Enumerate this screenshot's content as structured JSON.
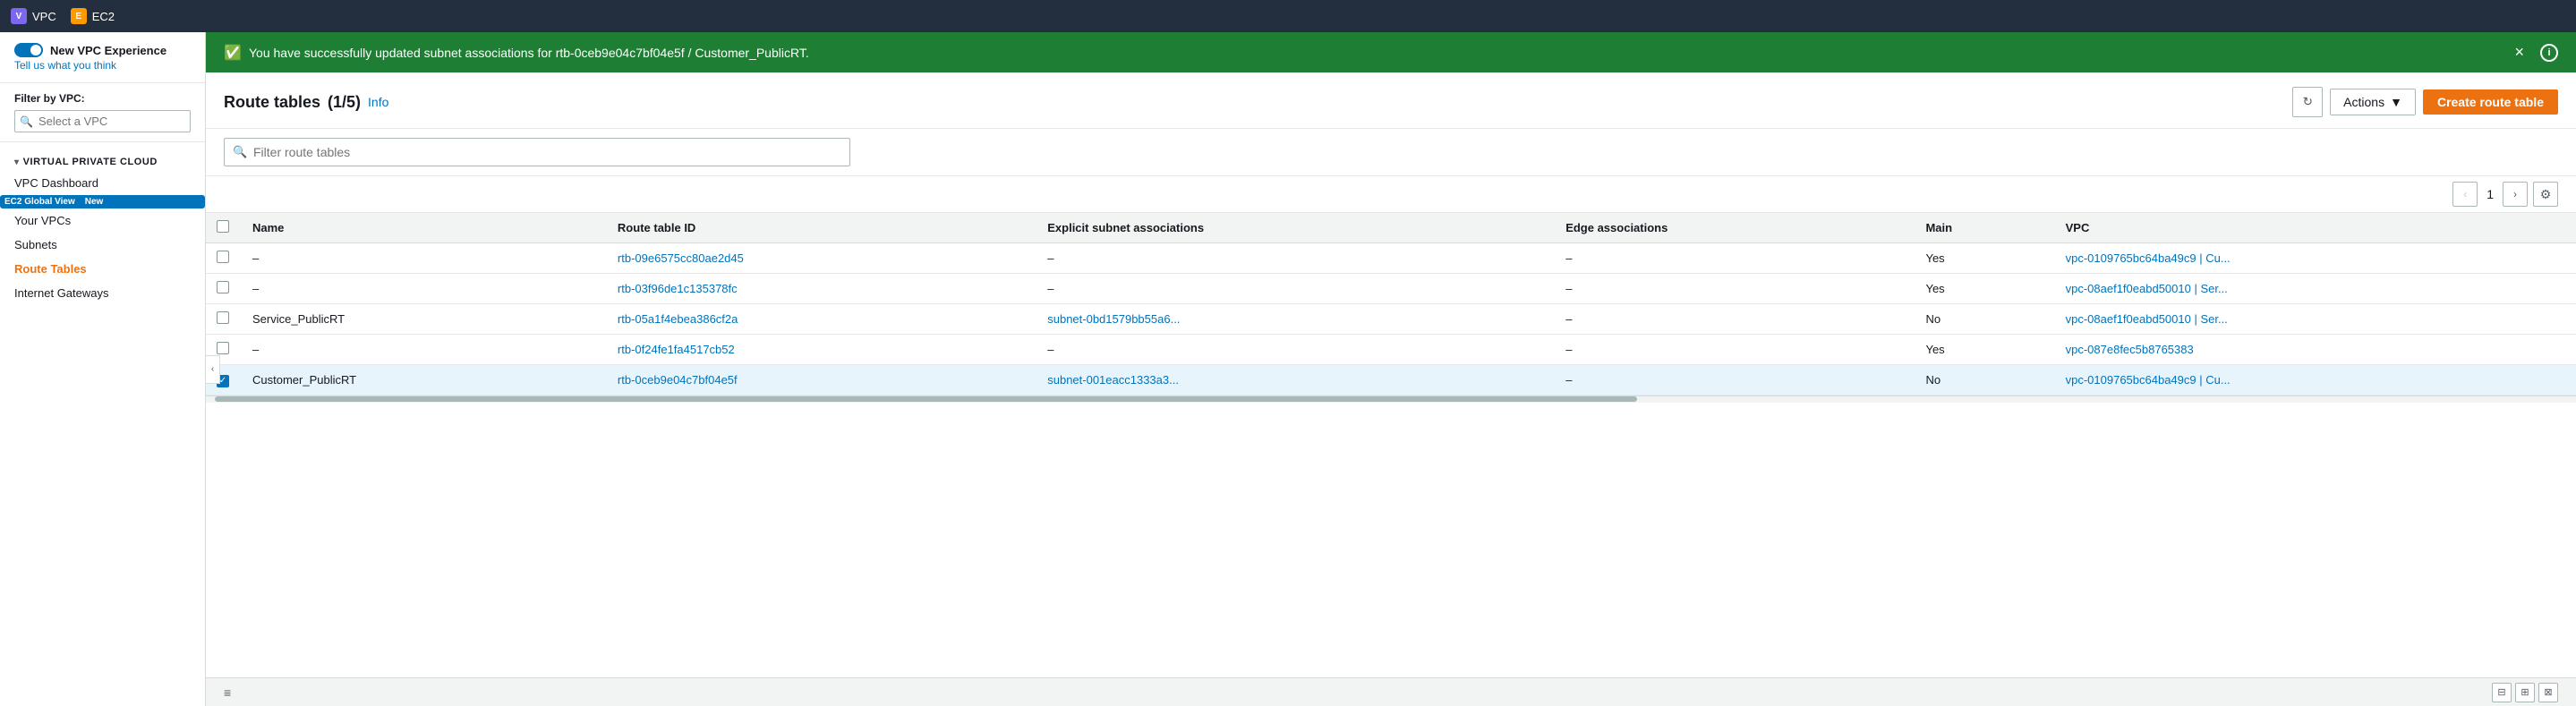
{
  "topNav": {
    "vpc_label": "VPC",
    "ec2_label": "EC2"
  },
  "sidebar": {
    "toggle_label": "New VPC Experience",
    "toggle_sub": "Tell us what you think",
    "filter_label": "Filter by VPC:",
    "filter_placeholder": "Select a VPC",
    "section_header": "VIRTUAL PRIVATE CLOUD",
    "nav_items": [
      {
        "label": "VPC Dashboard",
        "active": false,
        "new_badge": false
      },
      {
        "label": "EC2 Global View",
        "active": false,
        "new_badge": true
      },
      {
        "label": "Your VPCs",
        "active": false,
        "new_badge": false
      },
      {
        "label": "Subnets",
        "active": false,
        "new_badge": false
      },
      {
        "label": "Route Tables",
        "active": true,
        "new_badge": false
      },
      {
        "label": "Internet Gateways",
        "active": false,
        "new_badge": false
      }
    ]
  },
  "successBanner": {
    "message": "You have successfully updated subnet associations for rtb-0ceb9e04c7bf04e5f / Customer_PublicRT.",
    "close_label": "×"
  },
  "mainContent": {
    "title": "Route tables",
    "count": "(1/5)",
    "info_label": "Info",
    "refresh_title": "Refresh",
    "actions_label": "Actions",
    "actions_chevron": "▼",
    "create_label": "Create route table",
    "filter_placeholder": "Filter route tables",
    "pagination": {
      "prev_label": "‹",
      "page": "1",
      "next_label": "›",
      "settings_label": "⚙"
    },
    "table": {
      "columns": [
        {
          "key": "checkbox",
          "label": ""
        },
        {
          "key": "name",
          "label": "Name"
        },
        {
          "key": "route_table_id",
          "label": "Route table ID"
        },
        {
          "key": "explicit_subnet",
          "label": "Explicit subnet associations"
        },
        {
          "key": "edge_associations",
          "label": "Edge associations"
        },
        {
          "key": "main",
          "label": "Main"
        },
        {
          "key": "vpc",
          "label": "VPC"
        }
      ],
      "rows": [
        {
          "selected": false,
          "name": "–",
          "route_table_id": "rtb-09e6575cc80ae2d45",
          "explicit_subnet": "–",
          "edge_associations": "–",
          "main": "Yes",
          "vpc": "vpc-0109765bc64ba49c9 | Cu..."
        },
        {
          "selected": false,
          "name": "–",
          "route_table_id": "rtb-03f96de1c135378fc",
          "explicit_subnet": "–",
          "edge_associations": "–",
          "main": "Yes",
          "vpc": "vpc-08aef1f0eabd50010 | Ser..."
        },
        {
          "selected": false,
          "name": "Service_PublicRT",
          "route_table_id": "rtb-05a1f4ebea386cf2a",
          "explicit_subnet": "subnet-0bd1579bb55a6...",
          "edge_associations": "–",
          "main": "No",
          "vpc": "vpc-08aef1f0eabd50010 | Ser..."
        },
        {
          "selected": false,
          "name": "–",
          "route_table_id": "rtb-0f24fe1fa4517cb52",
          "explicit_subnet": "–",
          "edge_associations": "–",
          "main": "Yes",
          "vpc": "vpc-087e8fec5b8765383"
        },
        {
          "selected": true,
          "name": "Customer_PublicRT",
          "route_table_id": "rtb-0ceb9e04c7bf04e5f",
          "explicit_subnet": "subnet-001eacc1333a3...",
          "edge_associations": "–",
          "main": "No",
          "vpc": "vpc-0109765bc64ba49c9 | Cu..."
        }
      ]
    }
  },
  "bottomBar": {
    "handle_label": "≡",
    "panel_icons": [
      "⊞",
      "⊟",
      "⊠"
    ]
  }
}
